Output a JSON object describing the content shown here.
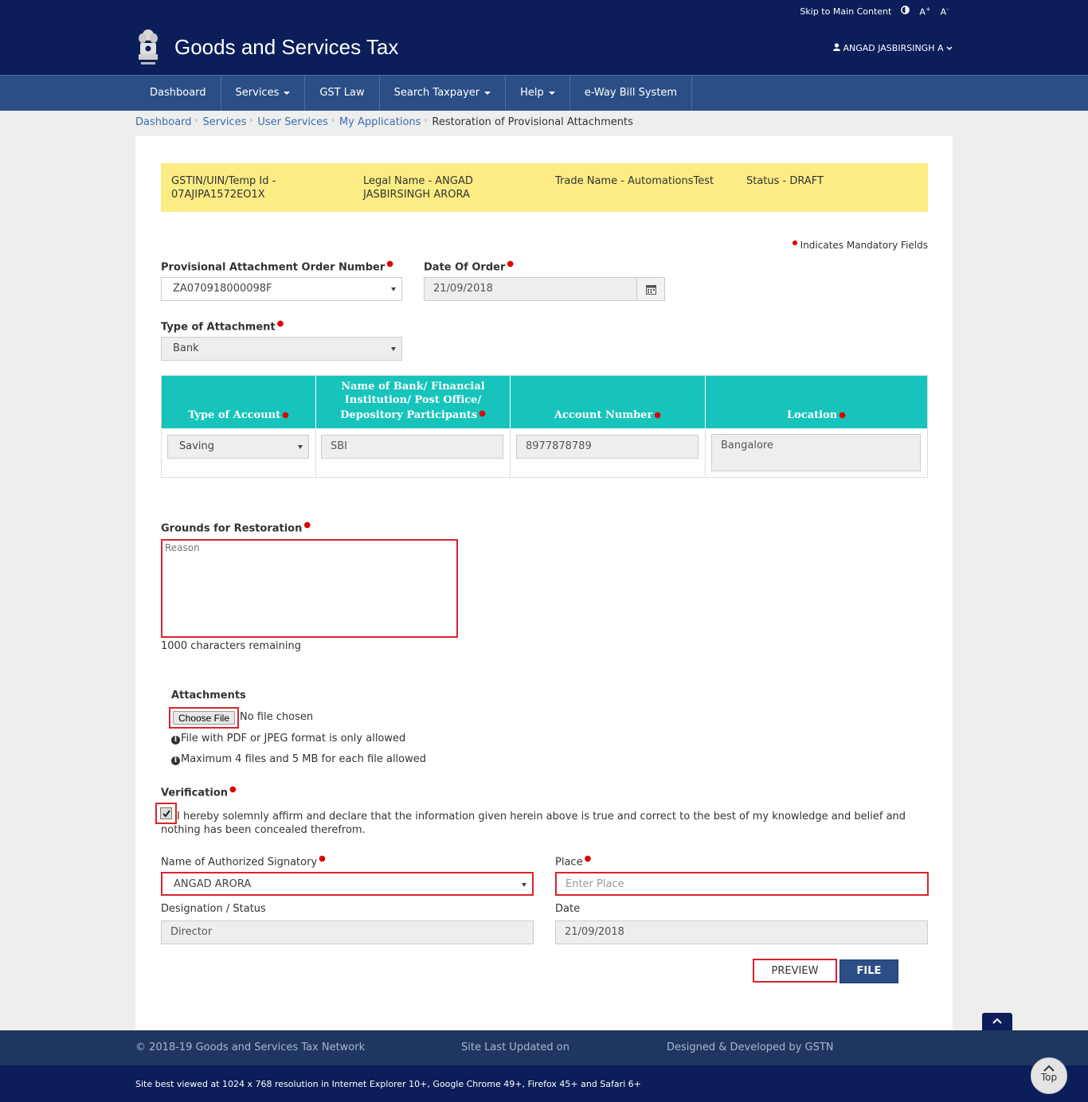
{
  "topbar": {
    "skip": "Skip to Main Content",
    "font_up": "A+",
    "font_down": "A-"
  },
  "header": {
    "title": "Goods and Services Tax",
    "user": "ANGAD JASBIRSINGH A"
  },
  "nav": {
    "items": [
      {
        "label": "Dashboard"
      },
      {
        "label": "Services"
      },
      {
        "label": "GST Law"
      },
      {
        "label": "Search Taxpayer"
      },
      {
        "label": "Help"
      },
      {
        "label": "e-Way Bill System"
      }
    ]
  },
  "breadcrumb": {
    "items": [
      "Dashboard",
      "Services",
      "User Services",
      "My Applications"
    ],
    "current": "Restoration of Provisional Attachments"
  },
  "info": {
    "gstin_label": "GSTIN/UIN/Temp Id -",
    "gstin_value": "07AJIPA1572EO1X",
    "legal_label": "Legal Name - ANGAD",
    "legal_value": "JASBIRSINGH ARORA",
    "trade": "Trade Name - AutomationsTest",
    "status": "Status - DRAFT"
  },
  "form": {
    "mandatory_note": "Indicates Mandatory Fields",
    "order_number_label": "Provisional Attachment Order Number",
    "order_number_value": "ZA070918000098F",
    "date_of_order_label": "Date Of Order",
    "date_of_order_value": "21/09/2018",
    "type_label": "Type of Attachment",
    "type_value": "Bank",
    "table": {
      "headers": {
        "account_type": "Type of Account",
        "bank_line1": "Name of Bank/ Financial",
        "bank_line2": "Institution/ Post Office/",
        "bank_line3": "Depository Participants",
        "account_number": "Account Number",
        "location": "Location"
      },
      "row": {
        "account_type": "Saving",
        "bank": "SBI",
        "account_number": "8977878789",
        "location": "Bangalore"
      }
    },
    "grounds_label": "Grounds for Restoration",
    "grounds_placeholder": "Reason",
    "chars_remaining": "1000 characters remaining",
    "attachments_label": "Attachments",
    "choose_file": "Choose File",
    "no_file": "No file chosen",
    "file_note1": "File with PDF or JPEG format is only allowed",
    "file_note2": "Maximum 4 files and 5 MB for each file allowed",
    "verification_label": "Verification",
    "declaration_line1": "I hereby solemnly affirm and declare that the information given herein above is true and correct to the best of my knowledge and belief and",
    "declaration_line2": "nothing has been concealed therefrom.",
    "signatory_label": "Name of Authorized Signatory",
    "signatory_value": "ANGAD ARORA",
    "place_label": "Place",
    "place_placeholder": "Enter Place",
    "designation_label": "Designation / Status",
    "designation_value": "Director",
    "date_label": "Date",
    "date_value": "21/09/2018",
    "preview_button": "PREVIEW",
    "file_button": "FILE"
  },
  "footer": {
    "copyright": "© 2018-19 Goods and Services Tax Network",
    "updated": "Site Last Updated on",
    "designed": "Designed & Developed by GSTN",
    "best_viewed": "Site best viewed at 1024 x 768 resolution in Internet Explorer 10+, Google Chrome 49+, Firefox 45+ and Safari 6+",
    "top": "Top"
  },
  "colors": {
    "navy": "#0b1e59",
    "nav_blue": "#2c4e86",
    "teal": "#17c4bb",
    "yellow": "#fcec84",
    "highlight_red": "#d9232e"
  }
}
